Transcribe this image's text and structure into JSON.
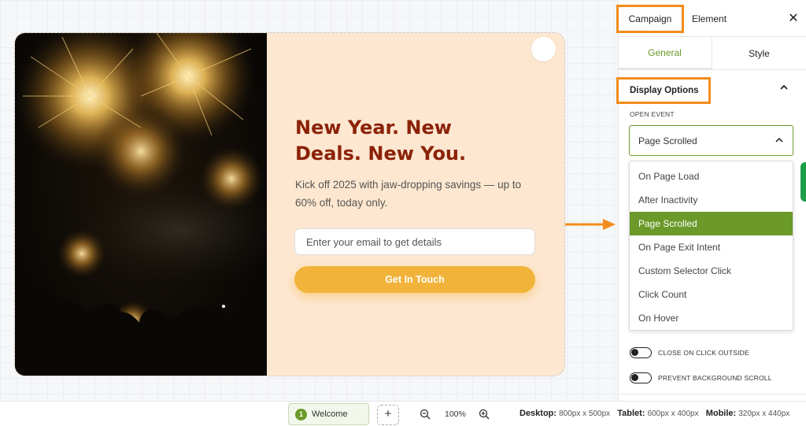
{
  "popup": {
    "title": "New Year. New Deals. New You.",
    "description": "Kick off 2025 with jaw-dropping savings — up to 60% off, today only.",
    "email_placeholder": "Enter your email to get details",
    "cta_label": "Get In Touch",
    "colors": {
      "background": "#fde7d0",
      "title": "#8b2208",
      "cta": "#f2b33a"
    }
  },
  "panel": {
    "tabs": [
      "Campaign",
      "Element"
    ],
    "close_icon": "close-icon",
    "subtabs": [
      "General",
      "Style"
    ],
    "section_title": "Display Options",
    "open_event_label": "OPEN EVENT",
    "open_event_value": "Page Scrolled",
    "options": [
      "On Page Load",
      "After Inactivity",
      "Page Scrolled",
      "On Page Exit Intent",
      "Custom Selector Click",
      "Click Count",
      "On Hover"
    ],
    "selected_option": "Page Scrolled",
    "toggles": [
      {
        "label": "CLOSE ON CLICK OUTSIDE",
        "on": false
      },
      {
        "label": "PREVENT BACKGROUND SCROLL",
        "on": false
      }
    ],
    "accent_color": "#6b9a2a",
    "highlight_color": "#f28c1b"
  },
  "bottombar": {
    "step_number": "1",
    "step_label": "Welcome",
    "add_label": "+",
    "zoom": "100%",
    "desktop_label": "Desktop:",
    "desktop_size": "800px x 500px",
    "tablet_label": "Tablet:",
    "tablet_size": "600px x 400px",
    "mobile_label": "Mobile:",
    "mobile_size": "320px x 440px"
  }
}
